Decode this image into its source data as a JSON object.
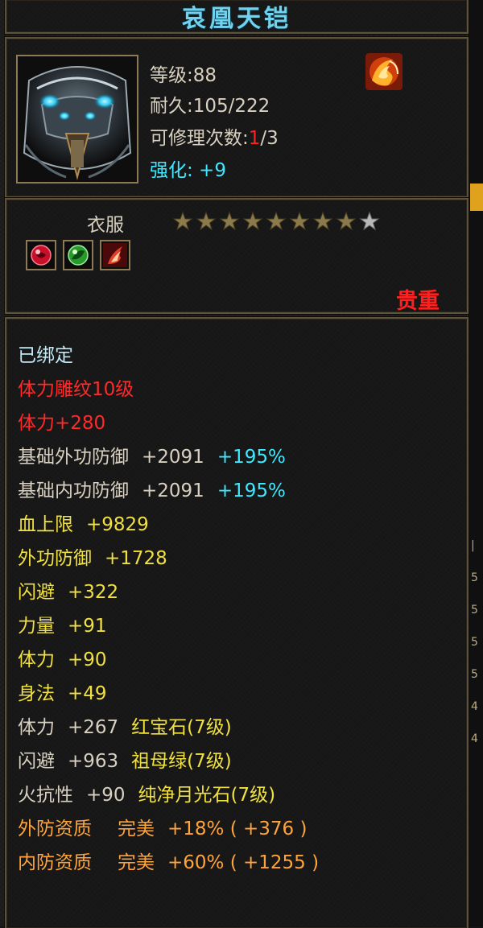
{
  "item": {
    "name": "哀凰天铠",
    "level_label": "等级",
    "level_value": ":88",
    "durability_label": "耐久",
    "durability_value": ":105/222",
    "repair_label": "可修理次数",
    "repair_sep": ":",
    "repair_used": "1",
    "repair_total": "/3",
    "enhance_label": "强化",
    "enhance_value": ": +9",
    "type": "衣服",
    "stars_total": 9,
    "stars_filled": 8,
    "rarity": "贵重"
  },
  "attributes": {
    "bound": "已绑定",
    "engrave": "体力雕纹10级",
    "engrave_bonus": "体力+280",
    "base_outer_def_label": "基础外功防御",
    "base_outer_def_value": "+2091",
    "base_outer_def_pct": "+195%",
    "base_inner_def_label": "基础内功防御",
    "base_inner_def_value": "+2091",
    "base_inner_def_pct": "+195%",
    "hp_label": "血上限",
    "hp_value": "+9829",
    "outer_def_label": "外功防御",
    "outer_def_value": "+1728",
    "dodge_label": "闪避",
    "dodge_value": "+322",
    "power_label": "力量",
    "power_value": "+91",
    "stamina_label": "体力",
    "stamina_value": "+90",
    "agility_label": "身法",
    "agility_value": "+49",
    "gem1_attr": "体力",
    "gem1_value": "+267",
    "gem1_name": "红宝石(7级)",
    "gem2_attr": "闪避",
    "gem2_value": "+963",
    "gem2_name": "祖母绿(7级)",
    "gem3_attr": "火抗性",
    "gem3_value": "+90",
    "gem3_name": "纯净月光石(7级)",
    "quality1_label": "外防资质",
    "quality1_grade": "完美",
    "quality1_value": "+18% ( +376 )",
    "quality2_label": "内防资质",
    "quality2_grade": "完美",
    "quality2_value": "+60% ( +1255 )"
  },
  "colors": {
    "title": "#6fd3ef",
    "enhance": "#3fe8ff",
    "rarity": "#ff2020",
    "engrave": "#ff2a2a",
    "stat": "#f0e040",
    "quality": "#ffa43a"
  },
  "icons": {
    "item": "armor-icon",
    "top_right": "fire-skill-icon",
    "gem_slots": [
      "red-gem-icon",
      "green-gem-icon",
      "flame-gem-icon"
    ]
  }
}
